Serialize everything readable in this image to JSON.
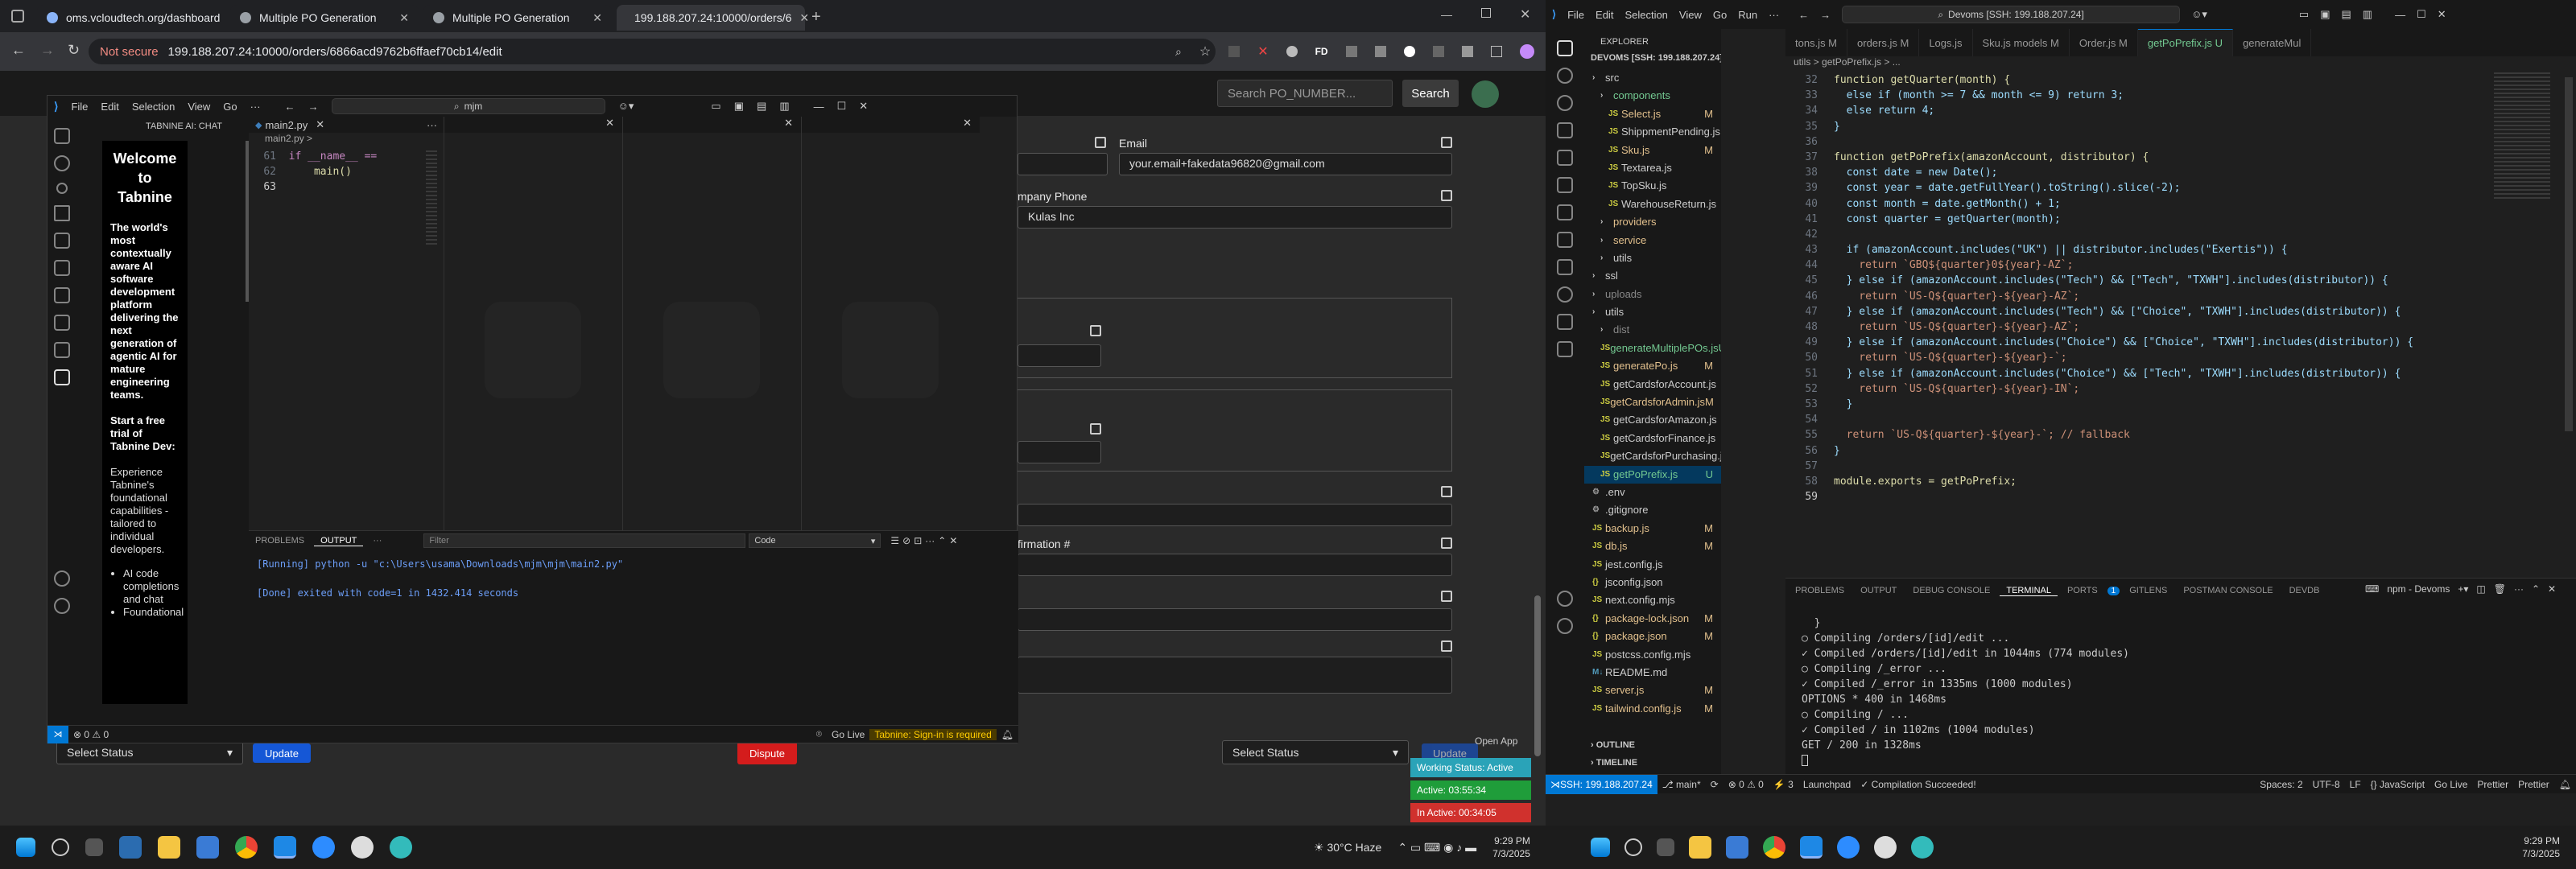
{
  "chrome": {
    "tabs": [
      {
        "label": "oms.vcloudtech.org/dashboard"
      },
      {
        "label": "Multiple PO Generation"
      },
      {
        "label": "Multiple PO Generation"
      },
      {
        "label": "199.188.207.24:10000/orders/6"
      }
    ],
    "url_secure": "Not secure",
    "url": "199.188.207.24:10000/orders/6866acd9762b6ffaef70cb14/edit"
  },
  "site": {
    "search_placeholder": "Search PO_NUMBER...",
    "search_btn": "Search",
    "email_label": "Email",
    "email_value": "your.email+fakedata96820@gmail.com",
    "company_phone_label": "mpany Phone",
    "company_value": "Kulas Inc",
    "confirmation_label": "firmation #",
    "select_status_1": "Select Status",
    "update_btn": "Update",
    "dispute_btn": "Dispute",
    "select_status_2": "Select Status",
    "update_btn_2": "Update",
    "open_app": "Open App",
    "working_status": "Working Status: Active",
    "active_time": "Active: 03:55:34",
    "inactive_time": "In Active: 00:34:05"
  },
  "vsc1": {
    "menu": [
      "File",
      "Edit",
      "Selection",
      "View",
      "Go"
    ],
    "search": "mjm",
    "sidebar_title": "TABNINE AI: CHAT",
    "welcome_title": "Welcome to Tabnine",
    "welcome_desc": "The world's most contextually aware AI software development platform delivering the next generation of agentic AI for mature engineering teams.",
    "trial": "Start a free trial of Tabnine Dev:",
    "experience": "Experience Tabnine's foundational capabilities - tailored to individual developers.",
    "bullets": [
      "AI code completions and chat",
      "Foundational"
    ],
    "editor_tab": "main2.py",
    "breadcrumb": "main2.py",
    "code": [
      {
        "n": "61",
        "t": "if __name__ == "
      },
      {
        "n": "62",
        "t": "    main()"
      },
      {
        "n": "63",
        "t": ""
      }
    ],
    "panel_tabs": [
      "PROBLEMS",
      "OUTPUT"
    ],
    "filter_placeholder": "Filter",
    "output_channel": "Code",
    "out_lines": [
      "[Running] python -u \"c:\\Users\\usama\\Downloads\\mjm\\mjm\\main2.py\"",
      "",
      "[Done] exited with code=1 in 1432.414 seconds"
    ],
    "status_errors": "0 ⚠ 0",
    "status_golive": "Go Live",
    "status_tabnine": "Tabnine: Sign-in is required"
  },
  "vsc2": {
    "menu": [
      "File",
      "Edit",
      "Selection",
      "View",
      "Go",
      "Run"
    ],
    "search": "Devoms [SSH: 199.188.207.24]",
    "explorer_title": "EXPLORER",
    "root": "DEVOMS [SSH: 199.188.207.24]",
    "tabs": [
      "tons.js M",
      "orders.js M",
      "Logs.js",
      "Sku.js models M",
      "Order.js M",
      "getPoPrefix.js U",
      "generateMul"
    ],
    "breadcrumb": "utils > getPoPrefix.js > ...",
    "tree": [
      {
        "n": "src",
        "d": 1,
        "type": "folder",
        "m": ""
      },
      {
        "n": "components",
        "d": 2,
        "type": "folder",
        "m": "",
        "c": "#73c991"
      },
      {
        "n": "Select.js",
        "d": 3,
        "type": "js",
        "m": "M",
        "c": "#e2c08d"
      },
      {
        "n": "ShippmentPending.js",
        "d": 3,
        "type": "js",
        "m": ""
      },
      {
        "n": "Sku.js",
        "d": 3,
        "type": "js",
        "m": "M",
        "c": "#e2c08d"
      },
      {
        "n": "Textarea.js",
        "d": 3,
        "type": "js",
        "m": ""
      },
      {
        "n": "TopSku.js",
        "d": 3,
        "type": "js",
        "m": ""
      },
      {
        "n": "WarehouseReturn.js",
        "d": 3,
        "type": "js",
        "m": ""
      },
      {
        "n": "providers",
        "d": 2,
        "type": "folder",
        "m": "",
        "c": "#e2c08d"
      },
      {
        "n": "service",
        "d": 2,
        "type": "folder",
        "m": "",
        "c": "#e2c08d"
      },
      {
        "n": "utils",
        "d": 2,
        "type": "folder",
        "m": ""
      },
      {
        "n": "ssl",
        "d": 1,
        "type": "folder",
        "m": ""
      },
      {
        "n": "uploads",
        "d": 1,
        "type": "folder",
        "m": "",
        "c": "#888"
      },
      {
        "n": "utils",
        "d": 1,
        "type": "folder",
        "m": ""
      },
      {
        "n": "dist",
        "d": 2,
        "type": "folder",
        "m": "",
        "c": "#888"
      },
      {
        "n": "generateMultiplePOs.js",
        "d": 2,
        "type": "js",
        "m": "U",
        "c": "#73c991"
      },
      {
        "n": "generatePo.js",
        "d": 2,
        "type": "js",
        "m": "M",
        "c": "#e2c08d"
      },
      {
        "n": "getCardsforAccount.js",
        "d": 2,
        "type": "js",
        "m": ""
      },
      {
        "n": "getCardsforAdmin.js",
        "d": 2,
        "type": "js",
        "m": "M",
        "c": "#e2c08d"
      },
      {
        "n": "getCardsforAmazon.js",
        "d": 2,
        "type": "js",
        "m": ""
      },
      {
        "n": "getCardsforFinance.js",
        "d": 2,
        "type": "js",
        "m": ""
      },
      {
        "n": "getCardsforPurchasing.js",
        "d": 2,
        "type": "js",
        "m": ""
      },
      {
        "n": "getPoPrefix.js",
        "d": 2,
        "type": "js",
        "m": "U",
        "c": "#73c991",
        "sel": true
      },
      {
        "n": ".env",
        "d": 1,
        "type": "env",
        "m": ""
      },
      {
        "n": ".gitignore",
        "d": 1,
        "type": "txt",
        "m": ""
      },
      {
        "n": "backup.js",
        "d": 1,
        "type": "js",
        "m": "M",
        "c": "#e2c08d"
      },
      {
        "n": "db.js",
        "d": 1,
        "type": "js",
        "m": "M",
        "c": "#e2c08d"
      },
      {
        "n": "jest.config.js",
        "d": 1,
        "type": "js",
        "m": ""
      },
      {
        "n": "jsconfig.json",
        "d": 1,
        "type": "json",
        "m": ""
      },
      {
        "n": "next.config.mjs",
        "d": 1,
        "type": "js",
        "m": ""
      },
      {
        "n": "package-lock.json",
        "d": 1,
        "type": "json",
        "m": "M",
        "c": "#e2c08d"
      },
      {
        "n": "package.json",
        "d": 1,
        "type": "json",
        "m": "M",
        "c": "#e2c08d"
      },
      {
        "n": "postcss.config.mjs",
        "d": 1,
        "type": "js",
        "m": ""
      },
      {
        "n": "README.md",
        "d": 1,
        "type": "md",
        "m": ""
      },
      {
        "n": "server.js",
        "d": 1,
        "type": "js",
        "m": "M",
        "c": "#e2c08d"
      },
      {
        "n": "tailwind.config.js",
        "d": 1,
        "type": "js",
        "m": "M",
        "c": "#e2c08d"
      }
    ],
    "outline": "OUTLINE",
    "timeline": "TIMELINE",
    "panel_tabs": [
      "PROBLEMS",
      "OUTPUT",
      "DEBUG CONSOLE",
      "TERMINAL",
      "PORTS",
      "GITLENS",
      "POSTMAN CONSOLE",
      "DEVDB"
    ],
    "ports_count": "1",
    "terminal_name": "npm - Devoms",
    "term_lines": [
      "  }",
      "○ Compiling /orders/[id]/edit ...",
      "✓ Compiled /orders/[id]/edit in 1044ms (774 modules)",
      "○ Compiling /_error ...",
      "✓ Compiled /_error in 1335ms (1000 modules)",
      "OPTIONS * 400 in 1468ms",
      "○ Compiling / ...",
      "✓ Compiled / in 1102ms (1004 modules)",
      "GET / 200 in 1328ms"
    ],
    "status": {
      "ssh": "SSH: 199.188.207.24",
      "branch": "main*",
      "errors": "⊗ 0 ⚠ 0",
      "warn3": "3",
      "launchpad": "Launchpad",
      "compile": "✓ Compilation Succeeded!",
      "spaces": "Spaces: 2",
      "enc": "UTF-8",
      "eol": "LF",
      "lang": "{} JavaScript",
      "golive": "Go Live",
      "prettier": "Prettier",
      "prettier2": "Prettier"
    }
  },
  "code2": {
    "start": 32,
    "lines": [
      "function getQuarter(month) {",
      "  else if (month >= 7 && month <= 9) return 3;",
      "  else return 4;",
      "}",
      "",
      "function getPoPrefix(amazonAccount, distributor) {",
      "  const date = new Date();",
      "  const year = date.getFullYear().toString().slice(-2);",
      "  const month = date.getMonth() + 1;",
      "  const quarter = getQuarter(month);",
      "",
      "  if (amazonAccount.includes(\"UK\") || distributor.includes(\"Exertis\")) {",
      "    return `GBQ${quarter}0${year}-AZ`;",
      "  } else if (amazonAccount.includes(\"Tech\") && [\"Tech\", \"TXWH\"].includes(distributor)) {",
      "    return `US-Q${quarter}-${year}-AZ`;",
      "  } else if (amazonAccount.includes(\"Tech\") && [\"Choice\", \"TXWH\"].includes(distributor)) {",
      "    return `US-Q${quarter}-${year}-AZ`;",
      "  } else if (amazonAccount.includes(\"Choice\") && [\"Choice\", \"TXWH\"].includes(distributor)) {",
      "    return `US-Q${quarter}-${year}-`;",
      "  } else if (amazonAccount.includes(\"Choice\") && [\"Tech\", \"TXWH\"].includes(distributor)) {",
      "    return `US-Q${quarter}-${year}-IN`;",
      "  }",
      "",
      "  return `US-Q${quarter}-${year}-`; // fallback",
      "}",
      "",
      "module.exports = getPoPrefix;",
      ""
    ]
  },
  "taskbar": {
    "weather": "30°C  Haze",
    "time": "9:29 PM",
    "date": "7/3/2025",
    "time2": "9:29 PM",
    "date2": "7/3/2025"
  }
}
